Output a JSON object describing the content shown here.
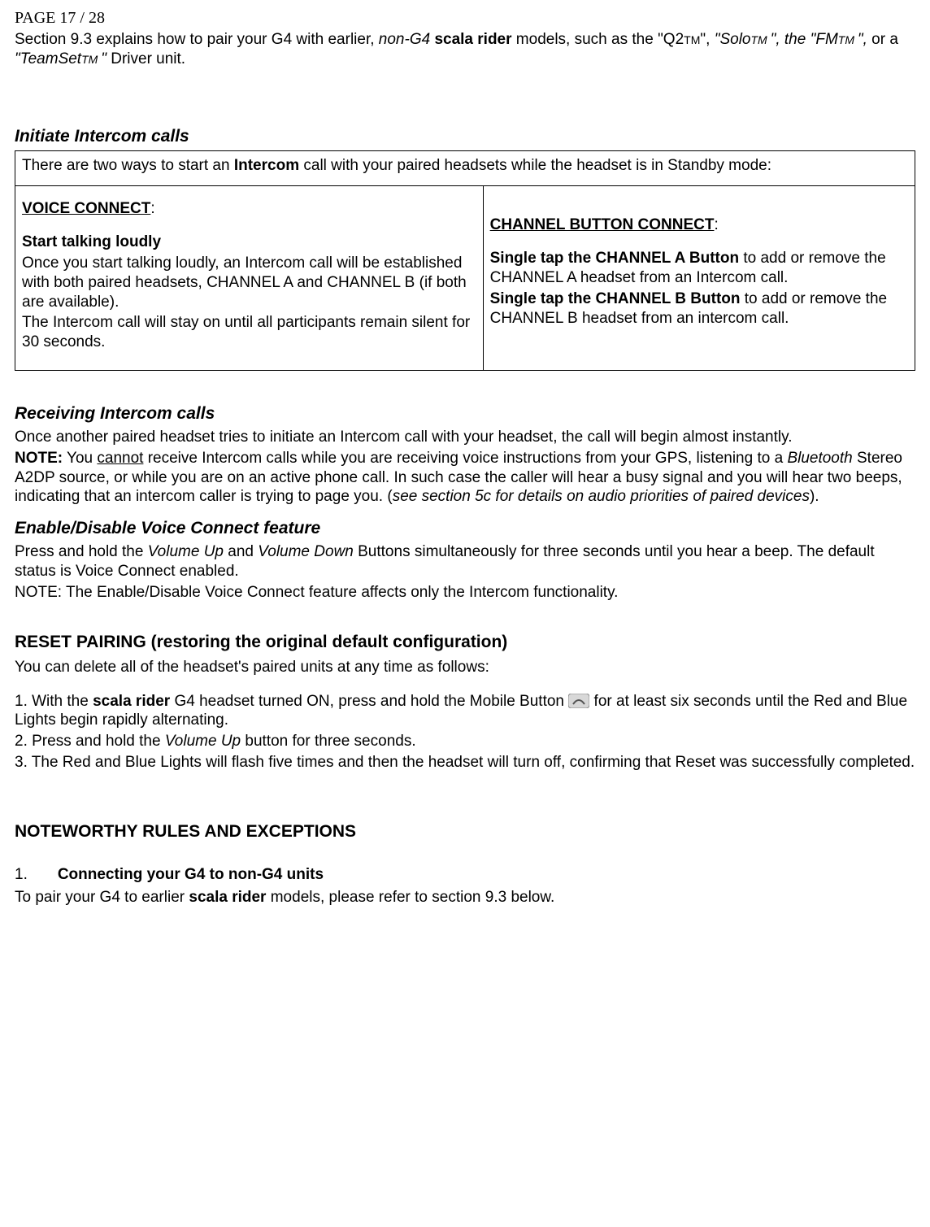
{
  "page": "PAGE 17 / 28",
  "intro": {
    "pre": "Section 9.3 explains how to pair your G4 with earlier, ",
    "nonG4": "non-G4",
    "sp1": " ",
    "scala": "scala rider",
    "post1": " models, such as the \"Q2",
    "tm1": "TM",
    "post2": "\", ",
    "solo": "\"Solo",
    "tm2": "TM ",
    "post3": "\", the \"FM",
    "tm3": "TM ",
    "post4": "\",",
    "post5": " or a ",
    "teamset": "\"TeamSet",
    "tm4": "TM ",
    "post6": "\"",
    "post7": " Driver unit."
  },
  "initiate": {
    "heading": "Initiate Intercom calls",
    "intro_pre": "There are two ways to start an ",
    "intro_b": "Intercom",
    "intro_post": " call with your paired headsets while the headset is in Standby mode:",
    "left": {
      "title": "VOICE CONNECT",
      "colon": ":",
      "sub": "Start talking loudly",
      "p1": "Once you start talking loudly, an Intercom call will be established with both paired headsets, CHANNEL A and CHANNEL B (if both are available).",
      "p2": "The Intercom call will stay on until all participants remain silent for 30 seconds."
    },
    "right": {
      "title": "CHANNEL BUTTON CONNECT",
      "colon": ":",
      "a_b": "Single tap the CHANNEL A Button",
      "a_rest": " to add or remove the CHANNEL A headset from an Intercom call.",
      "b_b": "Single tap the CHANNEL B Button",
      "b_rest": " to add or remove the CHANNEL B headset from an intercom call."
    }
  },
  "receiving": {
    "heading": "Receiving Intercom calls",
    "p1": "Once another paired headset tries to initiate an Intercom call with your headset, the call will begin almost instantly.",
    "note_b": "NOTE:",
    "note_pre": " You ",
    "note_u": "cannot",
    "note_mid1": " receive Intercom calls while you are receiving voice instructions from your GPS, listening to a ",
    "note_i1": "Bluetooth",
    "note_mid2": " Stereo A2DP source, or while you are on an active phone call. In such case the caller will hear a busy signal and you will hear two beeps, indicating that an intercom caller is trying to page you. (",
    "note_i2": "see section 5c for details on audio priorities of paired devices",
    "note_end": ")."
  },
  "enable": {
    "heading": "Enable/Disable Voice Connect feature",
    "p_pre": "Press and hold the ",
    "p_i1": "Volume Up",
    "p_mid": " and ",
    "p_i2": "Volume Down",
    "p_post": " Buttons simultaneously for three seconds until you hear a beep. The default status is Voice Connect enabled.",
    "note": "NOTE: The Enable/Disable Voice Connect feature affects only the Intercom functionality."
  },
  "reset": {
    "heading": "RESET PAIRING (restoring the original default configuration)",
    "intro": "You can delete all of the headset's paired units at any time as follows:",
    "s1_pre": "1. With the ",
    "s1_b": "scala rider",
    "s1_mid": " G4 headset turned ON, press and hold the Mobile Button ",
    "s1_post": " for at least six seconds until the Red and Blue Lights begin rapidly alternating.",
    "s2_pre": "2. Press and hold the ",
    "s2_i": "Volume Up",
    "s2_post": " button for three seconds.",
    "s3": "3. The Red and Blue Lights will flash five times and then the headset will turn off, confirming that Reset was successfully completed."
  },
  "noteworthy": {
    "heading": "NOTEWORTHY RULES AND EXCEPTIONS",
    "num": "1.",
    "title": "Connecting your G4 to non-G4 units",
    "p_pre": "To pair your G4 to earlier ",
    "p_b": "scala rider",
    "p_post": " models, please refer to section 9.3 below."
  }
}
